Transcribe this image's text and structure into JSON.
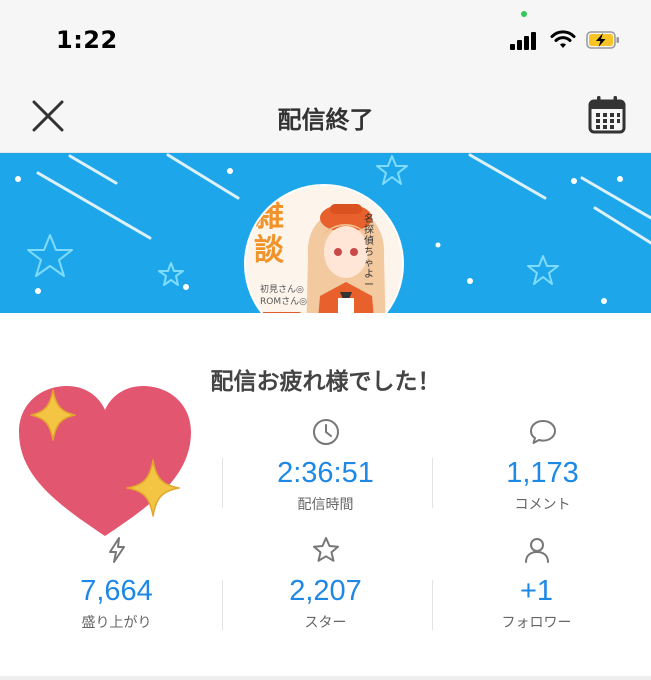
{
  "status": {
    "time": "1:22"
  },
  "nav": {
    "title": "配信終了"
  },
  "main": {
    "message": "配信お疲れ様でした！"
  },
  "avatar": {
    "title_chars": "雑談",
    "note": "名探偵ちゃよー",
    "sub_line1": "初見さん◎",
    "sub_line2": "ROMさん◎"
  },
  "stats": [
    {
      "value": "",
      "label": "",
      "icon": "heart-icon"
    },
    {
      "value": "2:36:51",
      "label": "配信時間",
      "icon": "clock-icon"
    },
    {
      "value": "1,173",
      "label": "コメント",
      "icon": "comment-icon"
    },
    {
      "value": "7,664",
      "label": "盛り上がり",
      "icon": "lightning-icon"
    },
    {
      "value": "2,207",
      "label": "スター",
      "icon": "star-icon"
    },
    {
      "value": "+1",
      "label": "フォロワー",
      "icon": "user-icon"
    }
  ],
  "colors": {
    "banner": "#1ea6ea",
    "value": "#1e88e5",
    "heart": "#e25670",
    "sparkle": "#f4c542"
  }
}
